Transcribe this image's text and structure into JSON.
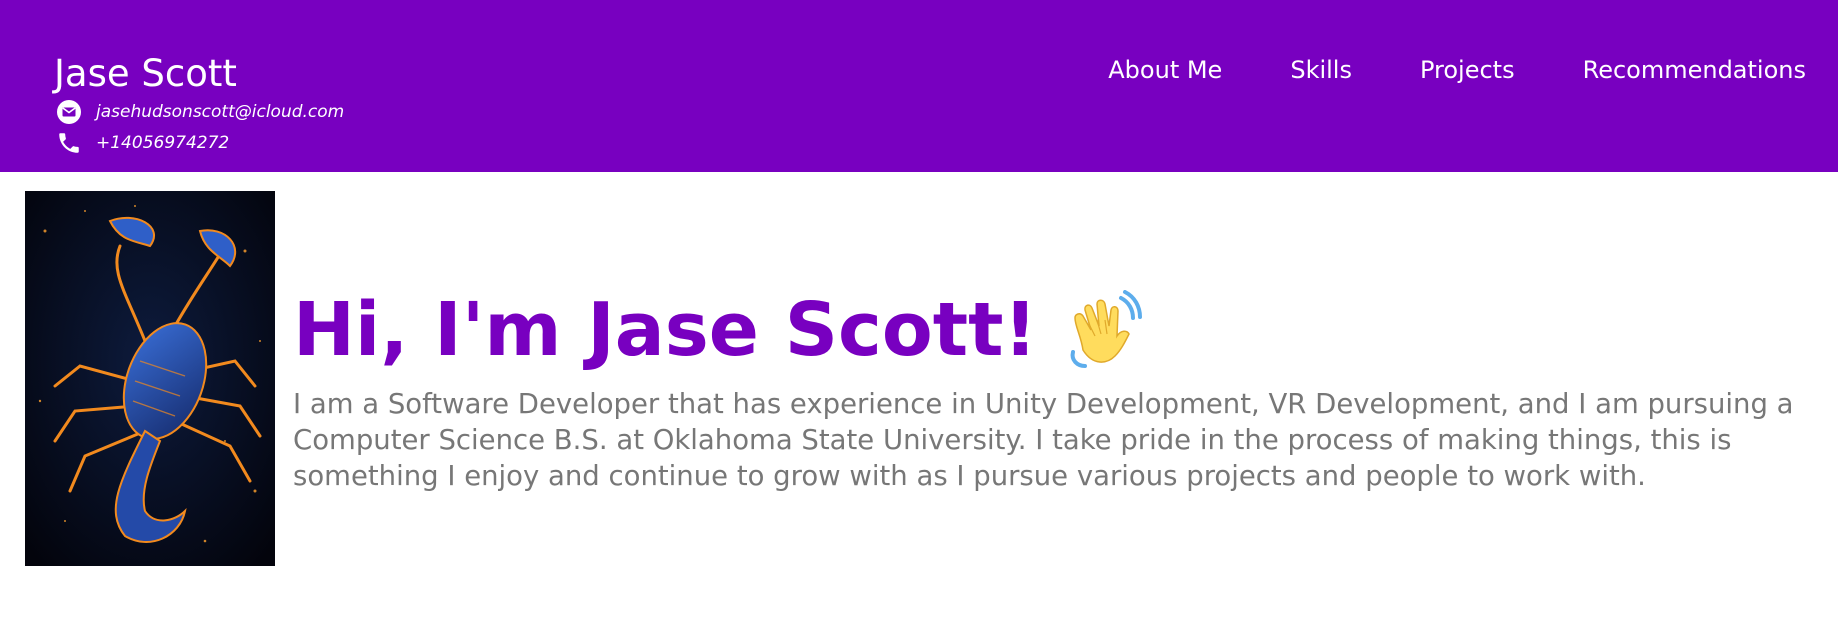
{
  "header": {
    "name": "Jase Scott",
    "email": "jasehudsonscott@icloud.com",
    "phone": "+14056974272",
    "nav": [
      {
        "label": "About Me"
      },
      {
        "label": "Skills"
      },
      {
        "label": "Projects"
      },
      {
        "label": "Recommendations"
      }
    ],
    "background": "#7800c0",
    "icons": {
      "email": "envelope-icon",
      "phone": "phone-icon"
    }
  },
  "hero": {
    "title": "Hi, I'm Jase Scott!",
    "wave_icon": "waving-hand-icon",
    "bio": "I am a Software Developer that has experience in Unity Development, VR Development, and I am pursuing a Computer Science B.S. at Oklahoma State University. I take pride in the process of making things, this is something I enjoy and continue to grow with as I pursue various projects and people to work with.",
    "title_color": "#7800c0",
    "text_color": "#777777"
  }
}
